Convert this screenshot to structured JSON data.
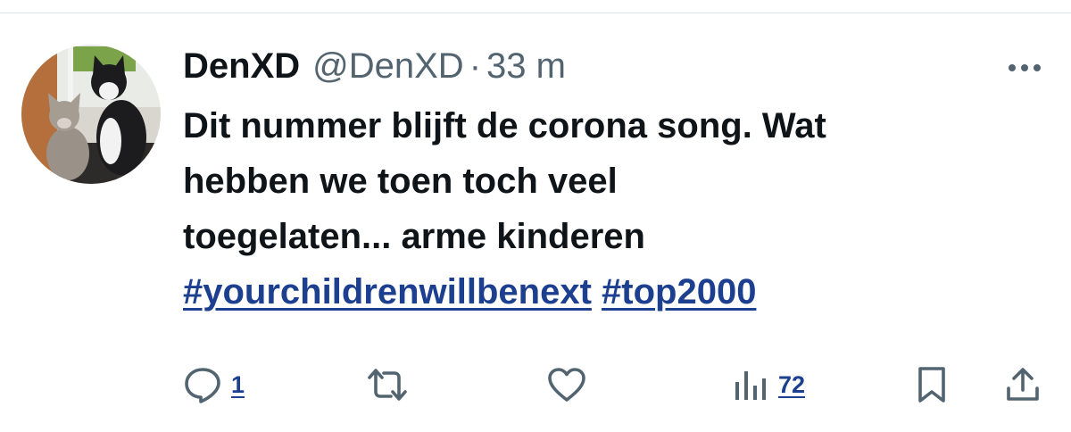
{
  "tweet": {
    "display_name": "DenXD",
    "handle": "@DenXD",
    "separator": "·",
    "time": "33 m",
    "text_lines": [
      "Dit nummer blijft de corona song. Wat",
      "hebben we toen toch veel",
      "toegelaten... arme kinderen"
    ],
    "hashtags": [
      "#yourchildrenwillbenext",
      "#top2000"
    ]
  },
  "icons": {
    "avatar": "cat-photo-avatar",
    "more": "more-icon",
    "reply": "reply-icon",
    "retweet": "retweet-icon",
    "like": "heart-icon",
    "views": "views-icon",
    "bookmark": "bookmark-icon",
    "share": "share-icon"
  },
  "actions": {
    "reply_count": "1",
    "views_count": "72"
  },
  "colors": {
    "text": "#0f1419",
    "secondary": "#536471",
    "link": "#1d3f8f",
    "icon": "#536471"
  }
}
